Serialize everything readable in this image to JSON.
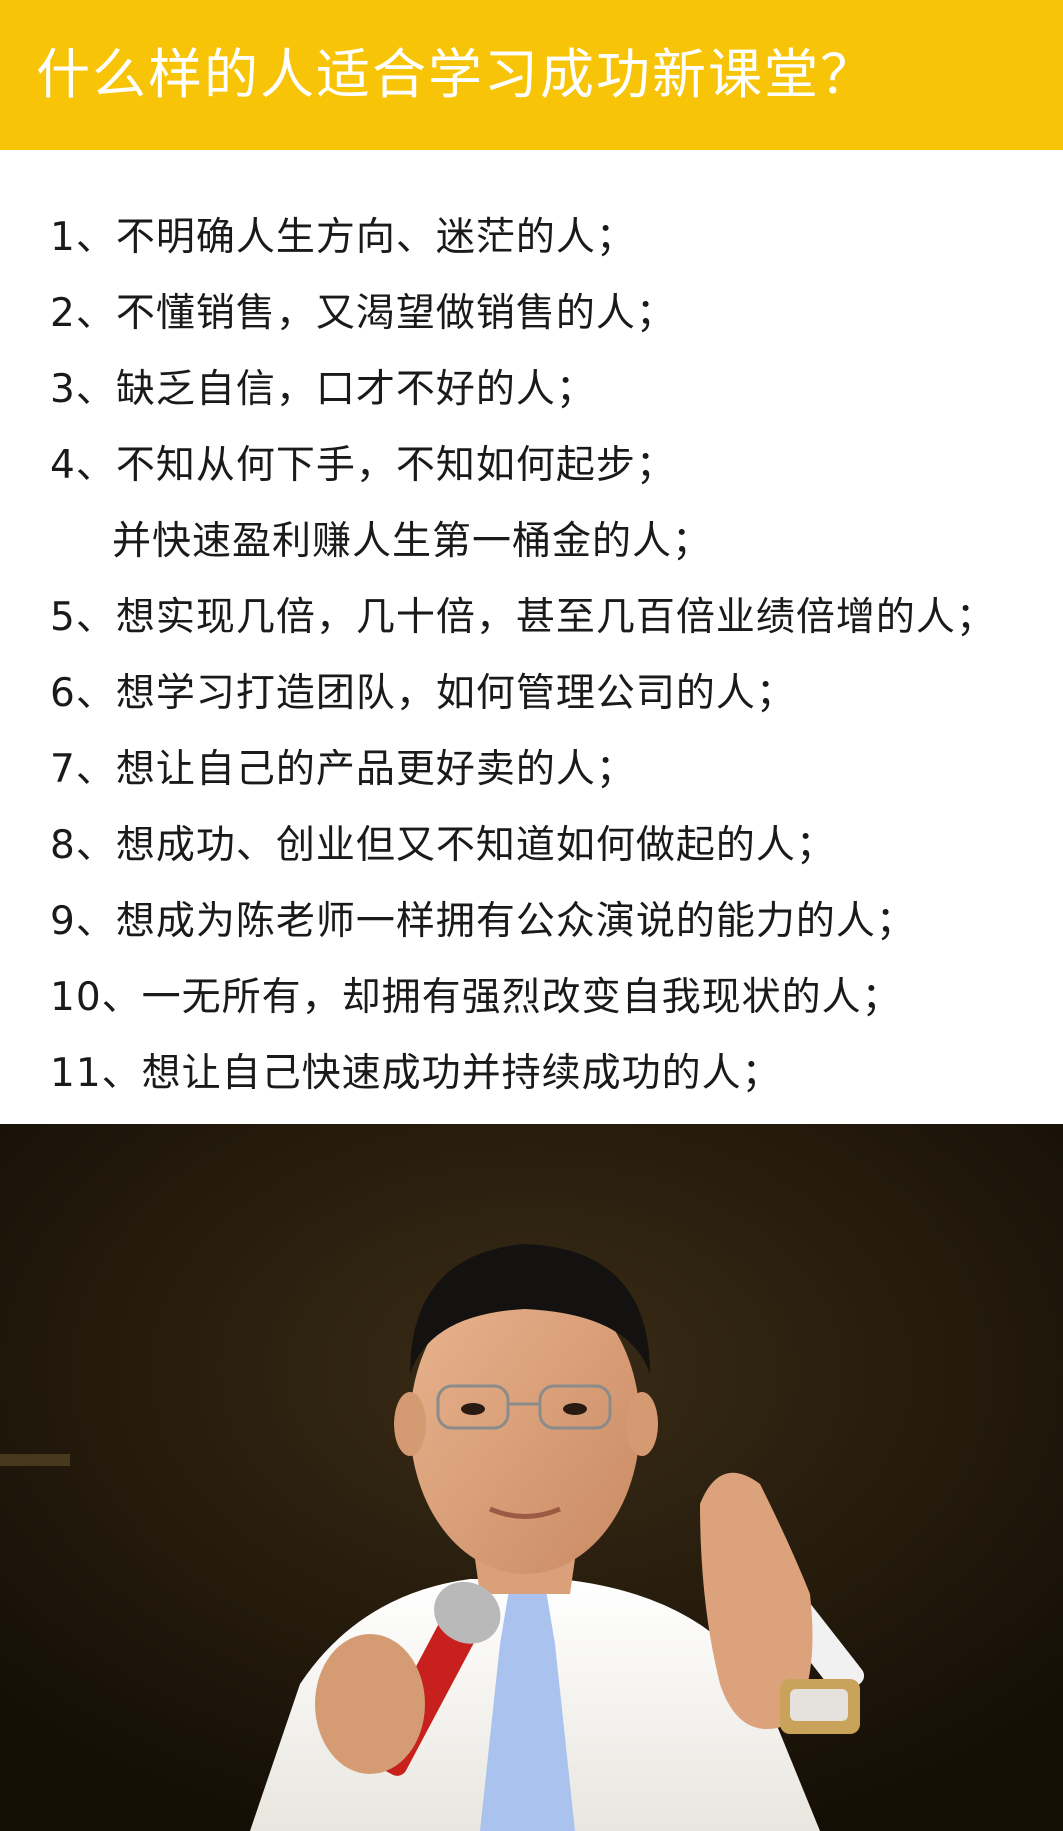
{
  "header": {
    "title": "什么样的人适合学习成功新课堂？",
    "background_color": "#f7c408",
    "text_color": "#ffffff"
  },
  "list": {
    "items": [
      "1、不明确人生方向、迷茫的人；",
      "2、不懂销售，又渴望做销售的人；",
      "3、缺乏自信，口才不好的人；",
      "4、不知从何下手，不知如何起步；",
      "并快速盈利赚人生第一桶金的人；",
      "5、想实现几倍，几十倍，甚至几百倍业绩倍增的人；",
      "6、想学习打造团队，如何管理公司的人；",
      "7、想让自己的产品更好卖的人；",
      "8、想成功、创业但又不知道如何做起的人；",
      "9、想成为陈老师一样拥有公众演说的能力的人；",
      "10、一无所有，却拥有强烈改变自我现状的人；",
      "11、想让自己快速成功并持续成功的人；"
    ]
  },
  "photo": {
    "icon": "speaker-photo"
  }
}
